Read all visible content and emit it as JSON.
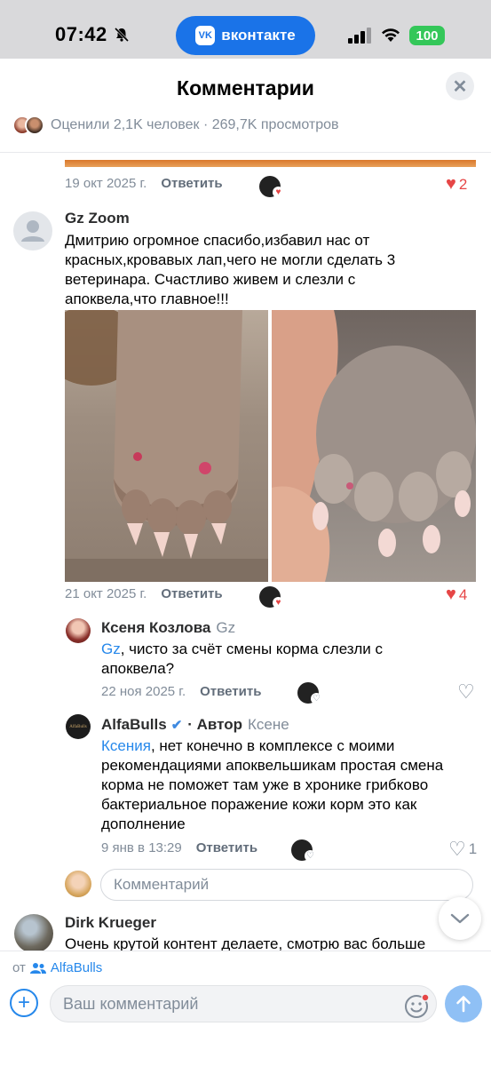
{
  "status": {
    "time": "07:42",
    "app_pill": "вконтакте",
    "battery": "100"
  },
  "sheet": {
    "title": "Комментарии",
    "rated": "Оценили 2,1K человек · 269,7K просмотров"
  },
  "reply_label": "Ответить",
  "top_comment": {
    "date": "19 окт 2025 г.",
    "likes": "2"
  },
  "comment_gz": {
    "author": "Gz Zoom",
    "text_lines": [
      "Дмитрию огромное спасибо,избавил нас от",
      "красных,кровавых лап,чего не могли сделать 3",
      "ветеринара.  Счастливо живем и слезли с",
      "апоквела,что главное!!!"
    ],
    "date": "21 окт 2025 г.",
    "likes": "4"
  },
  "reply_ksenya": {
    "author": "Ксеня Козлова",
    "to": "Gz",
    "mention": "Gz",
    "text_line1": ", чисто за счёт смены корма слезли с",
    "text_line2": "апоквела?",
    "date": "22 ноя 2025 г."
  },
  "reply_alfa": {
    "author": "AlfaBulls",
    "author_tag": "· Автор",
    "to": "Ксене",
    "mention": "Ксения",
    "text_line1": ", нет конечно в комплексе с моими",
    "text_lines": [
      "рекомендациями апоквельшикам простая смена",
      "корма не поможет там уже в хронике грибково",
      "бактериальное поражение кожи корм это как",
      "дополнение"
    ],
    "date": "9 янв в 13:29",
    "likes": "1",
    "avatar_text": "AlfaBulls"
  },
  "comment_input": {
    "placeholder": "Комментарий"
  },
  "comment_dirk": {
    "author": "Dirk Krueger",
    "text": "Очень крутой контент делаете, смотрю вас больше"
  },
  "bottom": {
    "from_label": "от",
    "group": "AlfaBulls",
    "placeholder": "Ваш комментарий"
  },
  "colors": {
    "accent": "#2688eb",
    "like_red": "#e64646",
    "vk_blue": "#1a73e8",
    "battery_green": "#34c759"
  }
}
